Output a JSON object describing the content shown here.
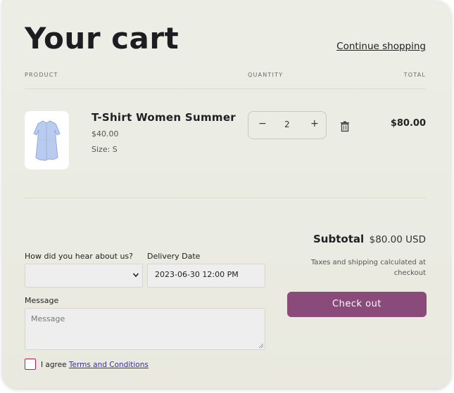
{
  "page": {
    "title": "Your cart",
    "continue_label": "Continue shopping"
  },
  "columns": {
    "product": "PRODUCT",
    "quantity": "QUANTITY",
    "total": "TOTAL"
  },
  "item": {
    "name": "T-Shirt Women Summer",
    "price": "$40.00",
    "size": "Size: S",
    "quantity": "2",
    "total": "$80.00",
    "image_icon": "light-blue-shirt-dress"
  },
  "summary": {
    "subtotal_label": "Subtotal",
    "subtotal_value": "$80.00 USD",
    "tax_note": "Taxes and shipping calculated at checkout",
    "checkout_label": "Check out"
  },
  "form": {
    "hear_label": "How did you hear about us?",
    "hear_value": "",
    "delivery_label": "Delivery Date",
    "delivery_value": "2023-06-30 12:00 PM",
    "message_label": "Message",
    "message_placeholder": "Message",
    "agree_text": "I agree",
    "terms_link": "Terms and Conditions"
  },
  "colors": {
    "accent": "#8a4a7a",
    "checkbox_border": "#c2185b",
    "link": "#3b2fa0"
  }
}
